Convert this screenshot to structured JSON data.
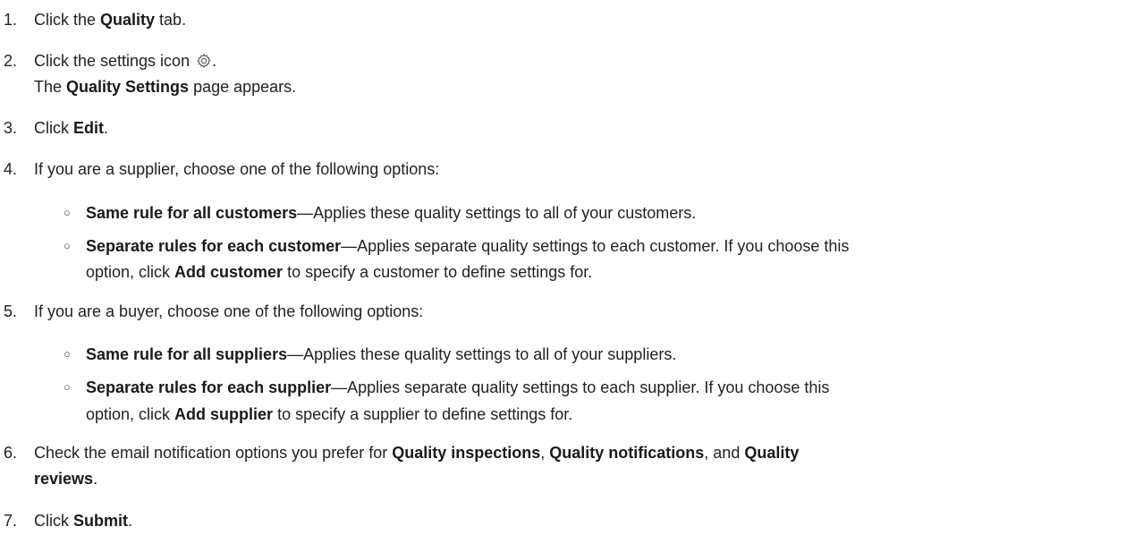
{
  "steps": [
    {
      "num": "1.",
      "p1": "Click the ",
      "b1": "Quality",
      "p2": " tab."
    },
    {
      "num": "2.",
      "p1": "Click the settings icon",
      "icon": "settings-gear-icon",
      "p2": ".",
      "line2_p1": "The ",
      "line2_b1": "Quality Settings",
      "line2_p2": " page appears."
    },
    {
      "num": "3.",
      "p1": "Click ",
      "b1": "Edit",
      "p2": "."
    },
    {
      "num": "4.",
      "p1": "If you are a supplier, choose one of the following options:",
      "options": [
        {
          "b": "Same rule for all customers",
          "t": "—Applies these quality settings to all of your customers."
        },
        {
          "b": "Separate rules for each customer",
          "t": "—Applies separate quality settings to each customer. If you choose this",
          "l2_p1": "option, click ",
          "l2_b": "Add customer",
          "l2_p2": " to specify a customer to define settings for."
        }
      ]
    },
    {
      "num": "5.",
      "p1": "If you are a buyer, choose one of the following options:",
      "options": [
        {
          "b": "Same rule for all suppliers",
          "t": "—Applies these quality settings to all of your suppliers."
        },
        {
          "b": "Separate rules for each supplier",
          "t": "—Applies separate quality settings to each supplier. If you choose this",
          "l2_p1": "option, click ",
          "l2_b": "Add supplier",
          "l2_p2": " to specify a supplier to define settings for."
        }
      ]
    },
    {
      "num": "6.",
      "p1": "Check the email notification options you prefer for ",
      "b1": "Quality inspections",
      "p2": ", ",
      "b2": "Quality notifications",
      "p3": ", and ",
      "b3": "Quality",
      "line2_b1": "reviews",
      "line2_p2": "."
    },
    {
      "num": "7.",
      "p1": "Click ",
      "b1": "Submit",
      "p2": "."
    }
  ],
  "bullet_glyph": "○"
}
